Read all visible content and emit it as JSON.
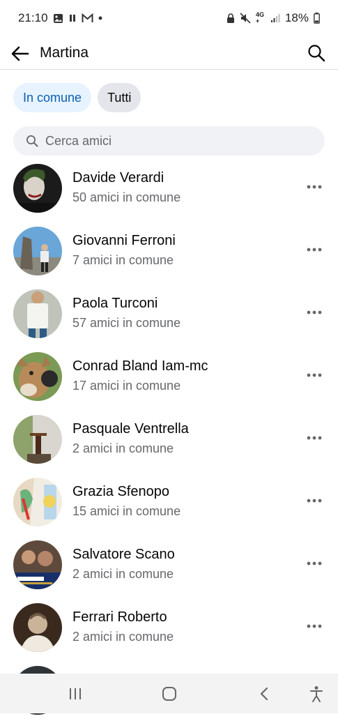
{
  "status_bar": {
    "time": "21:10",
    "battery": "18%",
    "network": "4G+",
    "icons": [
      "photo-icon",
      "pause-icon",
      "gmail-icon",
      "dot-icon",
      "lock-icon",
      "mute-icon",
      "signal-icon",
      "battery-icon"
    ]
  },
  "header": {
    "title": "Martina",
    "back_icon": "arrow-left-icon",
    "search_icon": "search-icon"
  },
  "filters": {
    "tabs": [
      {
        "label": "In comune",
        "active": true
      },
      {
        "label": "Tutti",
        "active": false
      }
    ]
  },
  "search": {
    "placeholder": "Cerca amici",
    "value": ""
  },
  "friends": [
    {
      "name": "Davide Verardi",
      "mutual": "50 amici in comune"
    },
    {
      "name": "Giovanni Ferroni",
      "mutual": "7 amici in comune"
    },
    {
      "name": "Paola Turconi",
      "mutual": "57 amici in comune"
    },
    {
      "name": "Conrad Bland Iam-mc",
      "mutual": "17 amici in comune"
    },
    {
      "name": "Pasquale Ventrella",
      "mutual": "2 amici in comune"
    },
    {
      "name": "Grazia Sfenopo",
      "mutual": "15 amici in comune"
    },
    {
      "name": "Salvatore Scano",
      "mutual": "2 amici in comune"
    },
    {
      "name": "Ferrari Roberto",
      "mutual": "2 amici in comune"
    }
  ],
  "nav_bar": {
    "icons": [
      "recent-apps-icon",
      "home-icon",
      "back-icon",
      "accessibility-icon"
    ]
  },
  "colors": {
    "accent": "#0a5fb4",
    "chip_active_bg": "#e7f3ff",
    "chip_inactive_bg": "#e4e6eb",
    "secondary_text": "#65676b"
  }
}
